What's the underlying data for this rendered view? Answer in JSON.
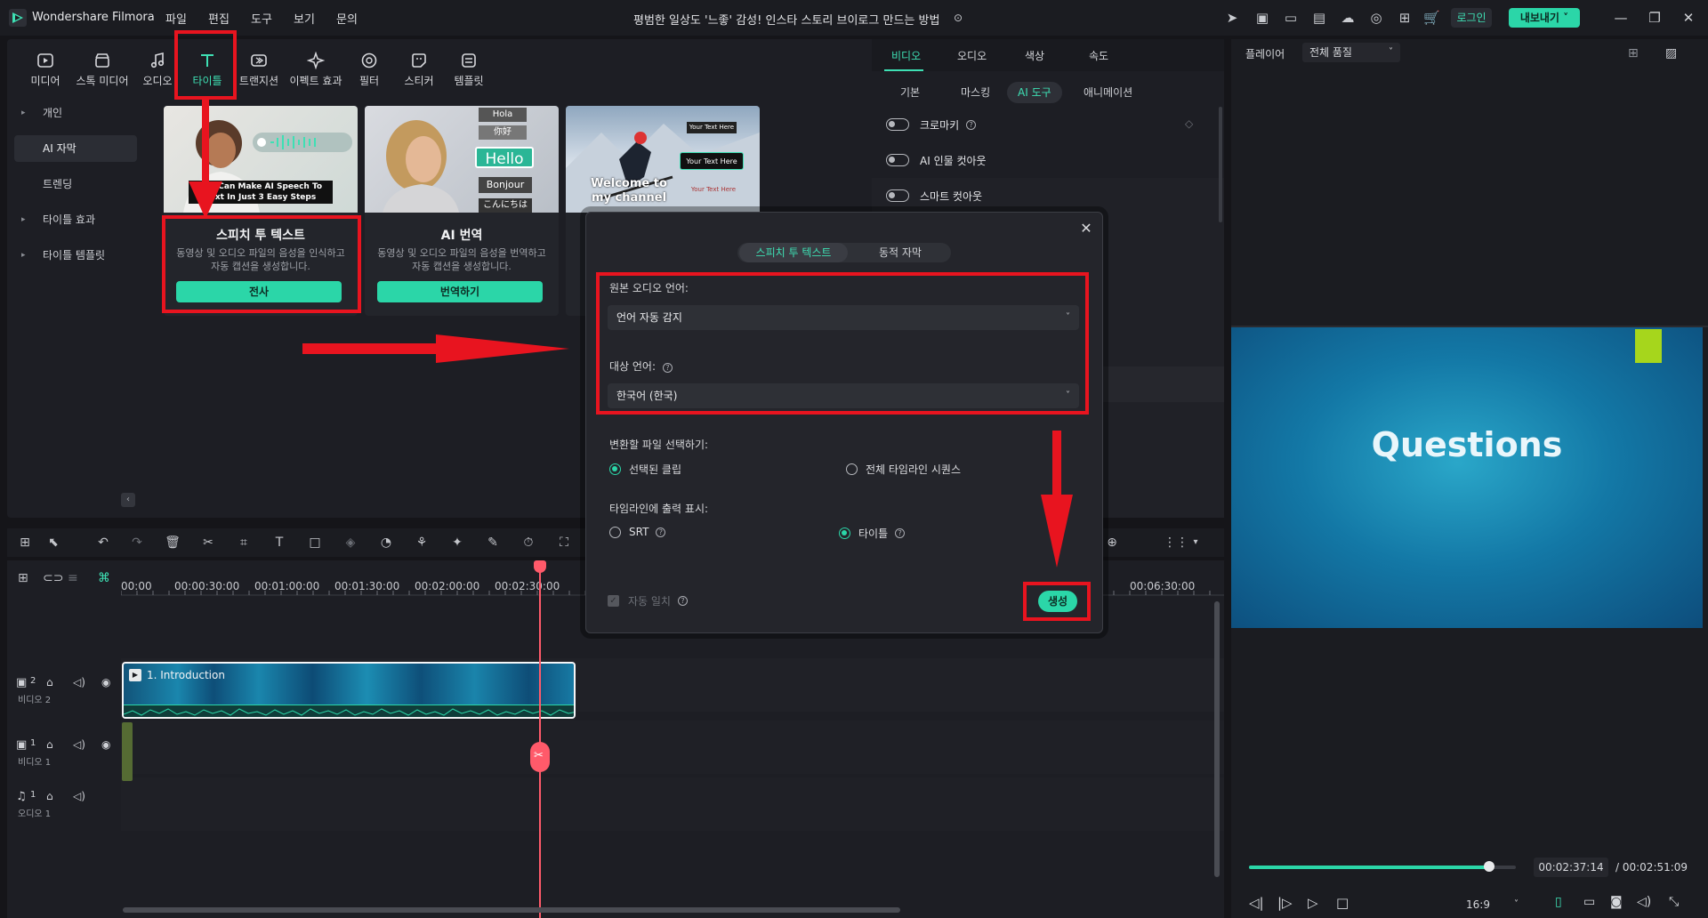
{
  "app": {
    "name": "Wondershare Filmora",
    "document_title": "평범한 일상도 '느좋' 감성! 인스타 스토리 브이로그 만드는 방법",
    "login_label": "로그인",
    "export_label": "내보내기"
  },
  "menu": [
    "파일",
    "편집",
    "도구",
    "보기",
    "문의"
  ],
  "library": {
    "tabs": [
      "미디어",
      "스톡 미디어",
      "오디오",
      "타이틀",
      "트랜지션",
      "이펙트 효과",
      "필터",
      "스티커",
      "템플릿"
    ],
    "active_tab": "타이틀",
    "sidebar": [
      "개인",
      "AI 자막",
      "트렌딩",
      "타이틀 효과",
      "타이틀 템플릿"
    ],
    "active_sidebar": "AI 자막",
    "cards": [
      {
        "title": "스피치 투 텍스트",
        "description": "동영상 및 오디오 파일의 음성을 인식하고 자동 캡션을 생성합니다.",
        "button": "전사",
        "thumb_text": "You Can Make AI Speech To Text In Just 3 Easy Steps"
      },
      {
        "title": "AI 번역",
        "description": "동영상 및 오디오 파일의 음성을 번역하고 자동 캡션을 생성합니다.",
        "button": "번역하기",
        "thumb_words": [
          "Hola",
          "你好",
          "Hello",
          "Bonjour",
          "こんにちは"
        ]
      },
      {
        "title": "",
        "description": "",
        "button": "",
        "thumb_text": "Welcome to my channel",
        "thumb_tags": [
          "Your Text Here",
          "Your Text Here",
          "Your Text Here"
        ]
      }
    ]
  },
  "properties": {
    "tabs": [
      "비디오",
      "오디오",
      "색상",
      "속도"
    ],
    "active_tab": "비디오",
    "subtabs": [
      "기본",
      "마스킹",
      "AI 도구",
      "애니메이션"
    ],
    "active_subtab": "AI 도구",
    "toggles": [
      {
        "label": "크로마키",
        "on": false
      },
      {
        "label": "AI 인물 컷아웃",
        "on": false
      },
      {
        "label": "스마트 컷아웃",
        "on": false
      }
    ]
  },
  "player": {
    "label": "플레이어",
    "quality": "전체 품질",
    "preview_text": "Questions",
    "current_time": "00:02:37:14",
    "total_time": "/ 00:02:51:09",
    "progress": 0.9,
    "aspect": "16:9"
  },
  "timeline": {
    "ruler": [
      "00:00",
      "00:00:30:00",
      "00:01:00:00",
      "00:01:30:00",
      "00:02:00:00",
      "00:02:30:00",
      "00:06:30:00"
    ],
    "tracks": [
      {
        "num": "2",
        "label": "비디오 2"
      },
      {
        "num": "1",
        "label": "비디오 1"
      },
      {
        "num": "1",
        "label": "오디오 1"
      }
    ],
    "clip_label": "1. Introduction"
  },
  "dialog": {
    "tabs": [
      "스피치 투 텍스트",
      "동적 자막"
    ],
    "active_tab": "스피치 투 텍스트",
    "source_label": "원본 오디오 언어:",
    "source_value": "언어 자동 감지",
    "target_label": "대상 언어:",
    "target_value": "한국어 (한국)",
    "convert_label": "변환할 파일 선택하기:",
    "convert_options": [
      "선택된 클립",
      "전체 타임라인 시퀀스"
    ],
    "convert_selected": "선택된 클립",
    "output_label": "타임라인에 출력 표시:",
    "output_options": [
      "SRT",
      "타이틀"
    ],
    "output_selected": "타이틀",
    "auto_sync": "자동 일치",
    "generate": "생성"
  },
  "colors": {
    "accent": "#2bd6a8",
    "annotation": "#e8141f",
    "playhead": "#ff5a6a"
  }
}
